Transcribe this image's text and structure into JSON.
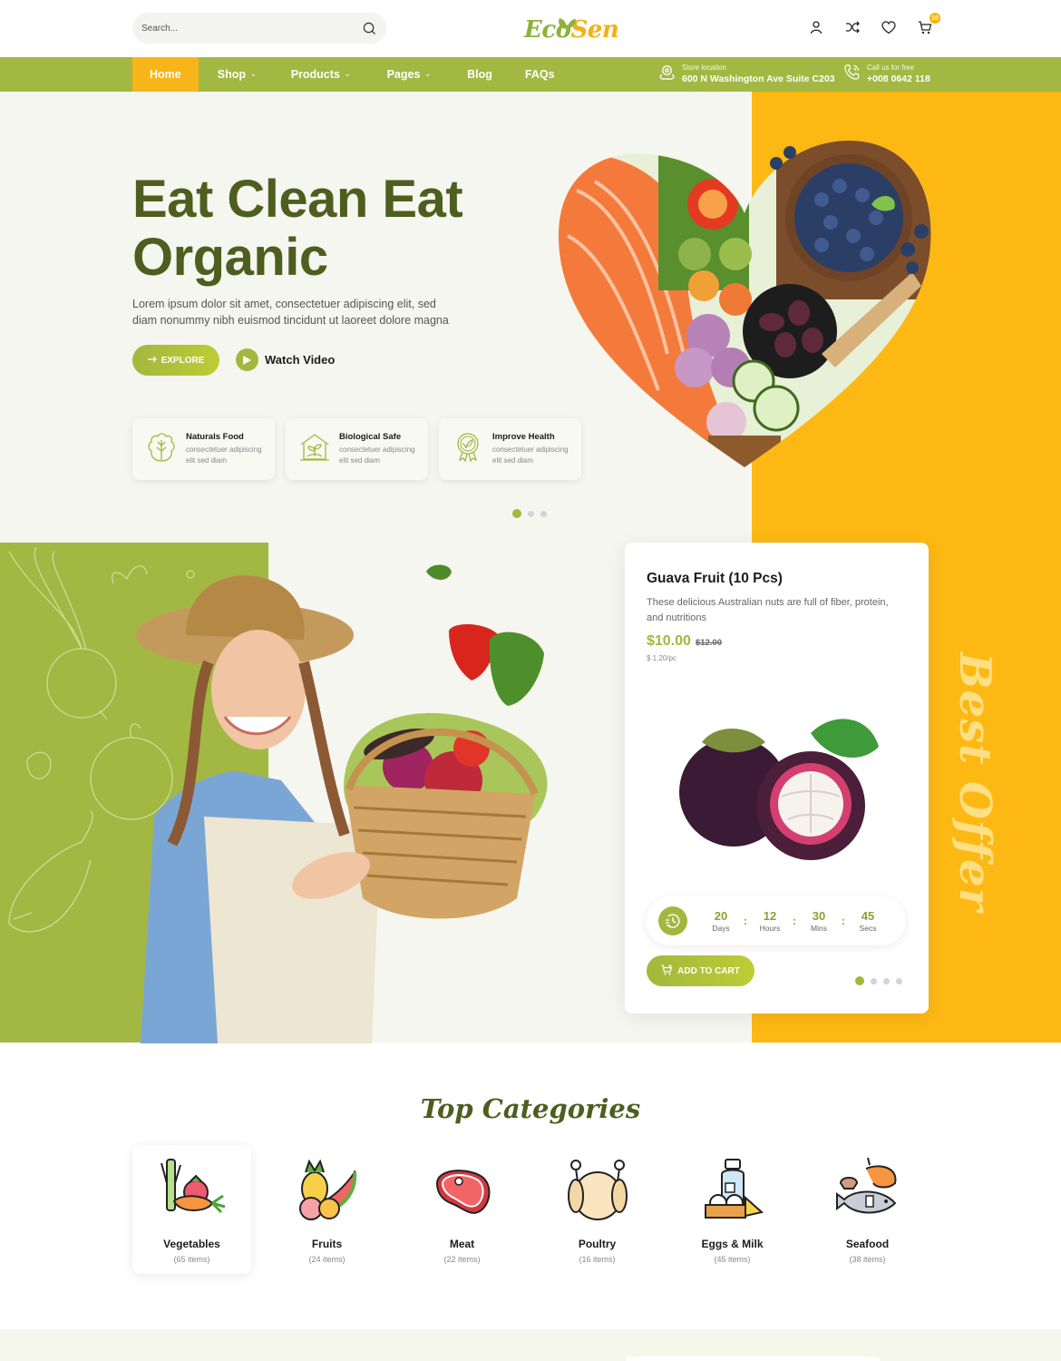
{
  "header": {
    "search_placeholder": "Search...",
    "logo_part1": "Eco",
    "logo_part2": "Sen",
    "cart_count": "10",
    "icons": [
      "user-icon",
      "shuffle-icon",
      "heart-icon",
      "cart-icon"
    ]
  },
  "nav": {
    "items": [
      {
        "label": "Home",
        "active": true,
        "dropdown": false
      },
      {
        "label": "Shop",
        "dropdown": true
      },
      {
        "label": "Products",
        "dropdown": true
      },
      {
        "label": "Pages",
        "dropdown": true
      },
      {
        "label": "Blog",
        "dropdown": false
      },
      {
        "label": "FAQs",
        "dropdown": false
      }
    ],
    "store": {
      "label": "Store location",
      "value": "600 N Washington Ave Suite C203"
    },
    "phone": {
      "label": "Call us for free",
      "value": "+008 0642 118"
    }
  },
  "hero": {
    "title_line1": "Eat Clean Eat",
    "title_line2": "Organic",
    "description": "Lorem ipsum dolor sit amet, consectetuer adipiscing elit, sed diam nonummy nibh euismod tincidunt ut laoreet dolore magna",
    "explore_label": "EXPLORE",
    "watch_label": "Watch Video",
    "features": [
      {
        "title": "Naturals Food",
        "desc": "consectetuer adipiscing elit sed diam",
        "icon": "lettuce-icon"
      },
      {
        "title": "Biological Safe",
        "desc": "consectetuer adipiscing elit sed diam",
        "icon": "greenhouse-icon"
      },
      {
        "title": "Improve Health",
        "desc": "consectetuer adipiscing elit sed diam",
        "icon": "badge-leaf-icon"
      }
    ],
    "slider_dots": 3,
    "slider_active": 0
  },
  "offer": {
    "title": "Guava Fruit (10 Pcs)",
    "description": "These delicious Australian nuts are full of fiber, protein, and nutritions",
    "price": "$10.00",
    "old_price": "$12.00",
    "unit_price": "$ 1.20/pc",
    "countdown": [
      {
        "value": "20",
        "label": "Days"
      },
      {
        "value": "12",
        "label": "Hours"
      },
      {
        "value": "30",
        "label": "Mins"
      },
      {
        "value": "45",
        "label": "Secs"
      }
    ],
    "add_to_cart": "ADD TO CART",
    "side_label": "Best Offer",
    "slider_dots": 4,
    "slider_active": 0
  },
  "categories": {
    "title": "Top Categories",
    "items": [
      {
        "name": "Vegetables",
        "count": "(65 items)",
        "active": true
      },
      {
        "name": "Fruits",
        "count": "(24 items)"
      },
      {
        "name": "Meat",
        "count": "(22 items)"
      },
      {
        "name": "Poultry",
        "count": "(16 items)"
      },
      {
        "name": "Eggs & Milk",
        "count": "(45 items)"
      },
      {
        "name": "Seafood",
        "count": "(38 items)"
      }
    ]
  },
  "colors": {
    "brand_green": "#a2b842",
    "dark_green": "#4d5e1f",
    "accent_yellow": "#fdb813",
    "hero_bg": "#f5f6ef"
  }
}
